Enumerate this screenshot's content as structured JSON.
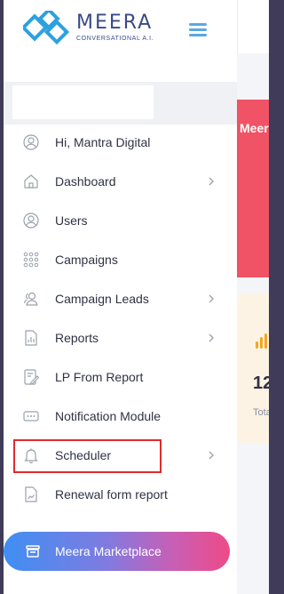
{
  "brand": {
    "name": "MEERA",
    "tagline": "CONVERSATIONAL A.I."
  },
  "search": {
    "value": "",
    "placeholder": ""
  },
  "sidebar": {
    "items": [
      {
        "label": "Hi, Mantra Digital",
        "icon": "user-circle-icon",
        "has_submenu": false
      },
      {
        "label": "Dashboard",
        "icon": "home-icon",
        "has_submenu": true
      },
      {
        "label": "Users",
        "icon": "user-circle-icon",
        "has_submenu": false
      },
      {
        "label": "Campaigns",
        "icon": "grid-dots-icon",
        "has_submenu": false
      },
      {
        "label": "Campaign Leads",
        "icon": "users-icon",
        "has_submenu": true
      },
      {
        "label": "Reports",
        "icon": "report-icon",
        "has_submenu": true
      },
      {
        "label": "LP From Report",
        "icon": "form-edit-icon",
        "has_submenu": false
      },
      {
        "label": "Notification Module",
        "icon": "message-icon",
        "has_submenu": false
      },
      {
        "label": "Scheduler",
        "icon": "bell-icon",
        "has_submenu": true,
        "highlighted": true
      },
      {
        "label": "Renewal form report",
        "icon": "chart-file-icon",
        "has_submenu": false
      }
    ]
  },
  "marketplace": {
    "label": "Meera Marketplace",
    "icon": "store-icon"
  },
  "content": {
    "banner_text": "Meera",
    "card_number": "12",
    "card_label": "Total"
  },
  "colors": {
    "brand_blue": "#3a4a87",
    "accent_blue": "#5ba7e4",
    "banner_red": "#f05366",
    "highlight_red": "#e02b2b",
    "card_bg": "#fdf3e4",
    "bar_orange": "#f5a623"
  }
}
